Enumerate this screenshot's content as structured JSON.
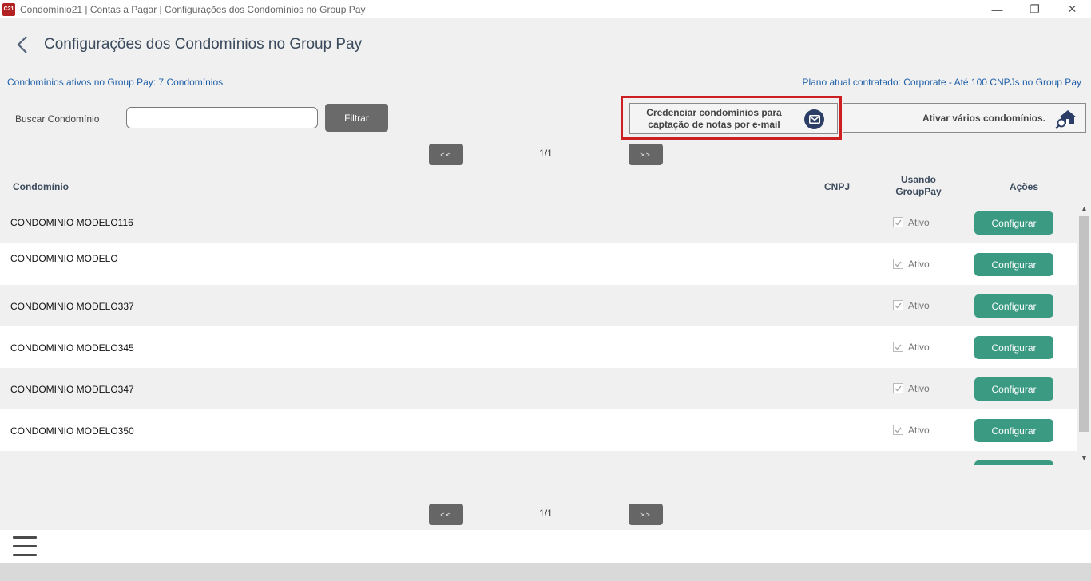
{
  "window": {
    "logo_text": "C21",
    "title": "Condomínio21 | Contas a Pagar | Configurações dos Condomínios no Group Pay",
    "minimize": "—",
    "restore": "❐",
    "close": "✕"
  },
  "header": {
    "title": "Configurações dos Condomínios no Group Pay",
    "active_count": "Condomínios ativos no Group Pay: 7 Condomínios",
    "plan_info": "Plano atual contratado: Corporate - Até 100 CNPJs no Group Pay"
  },
  "search": {
    "label": "Buscar Condomínio",
    "value": "",
    "placeholder": "",
    "filter_label": "Filtrar"
  },
  "actions": {
    "credentials_line1": "Credenciar condomínios para",
    "credentials_line2": "captação de notas por e-mail",
    "activate_many": "Ativar vários condomínios."
  },
  "pagination": {
    "prev": "<<",
    "next": ">>",
    "info": "1/1"
  },
  "table": {
    "columns": {
      "name": "Condomínio",
      "cnpj": "CNPJ",
      "using_line1": "Usando",
      "using_line2": "GroupPay",
      "actions": "Ações"
    },
    "rows": [
      {
        "name": "CONDOMINIO MODELO116",
        "cnpj": "",
        "status": "Ativo",
        "action": "Configurar"
      },
      {
        "name": "CONDOMINIO  MODELO",
        "cnpj": "",
        "status": "Ativo",
        "action": "Configurar"
      },
      {
        "name": "CONDOMINIO MODELO337",
        "cnpj": "",
        "status": "Ativo",
        "action": "Configurar"
      },
      {
        "name": "CONDOMINIO MODELO345",
        "cnpj": "",
        "status": "Ativo",
        "action": "Configurar"
      },
      {
        "name": "CONDOMINIO MODELO347",
        "cnpj": "",
        "status": "Ativo",
        "action": "Configurar"
      },
      {
        "name": "CONDOMINIO MODELO350",
        "cnpj": "",
        "status": "Ativo",
        "action": "Configurar"
      },
      {
        "name": "",
        "cnpj": "",
        "status": "",
        "action": ""
      }
    ]
  },
  "colors": {
    "accent_button": "#3a9a82",
    "link_text": "#1f5fa8",
    "highlight": "#cc1f1f",
    "dark_button": "#666666"
  }
}
